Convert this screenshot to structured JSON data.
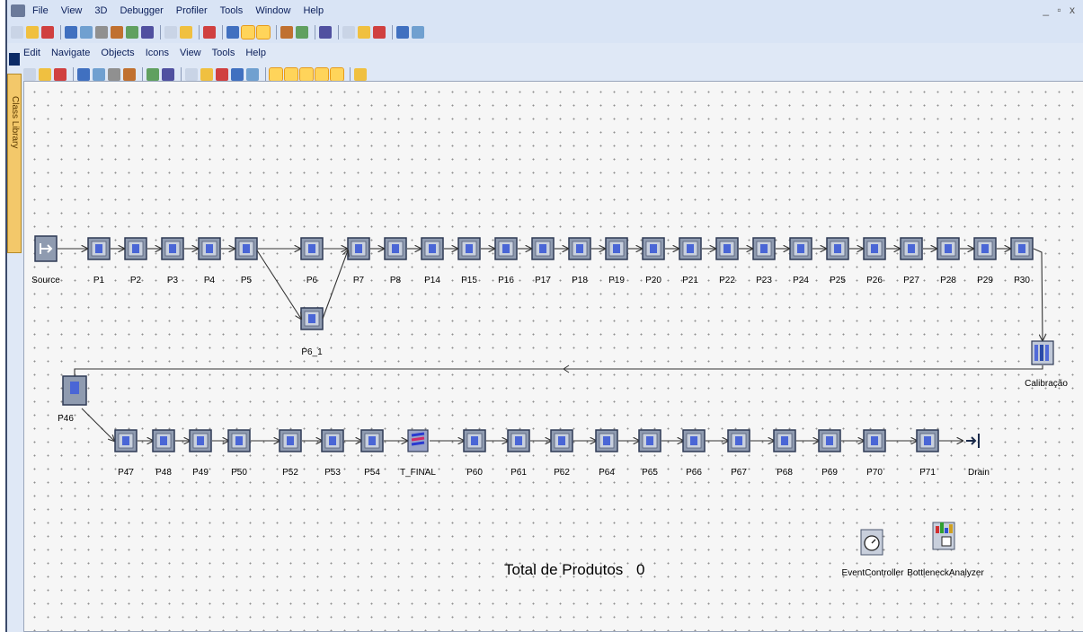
{
  "main_menu": [
    "File",
    "View",
    "3D",
    "Debugger",
    "Profiler",
    "Tools",
    "Window",
    "Help"
  ],
  "window_controls": "_ ▫ x",
  "sub_menu": [
    "Edit",
    "Navigate",
    "Objects",
    "Icons",
    "View",
    "Tools",
    "Help"
  ],
  "class_library_label": "Class Library",
  "toolbar_top_icons": [
    "new-icon",
    "open-icon",
    "open-folder-icon",
    "save-icon",
    "save-all-icon",
    "frame-icon",
    "frame-red-icon",
    "dialog-icon",
    "wizard-icon",
    "library-icon",
    "network-icon",
    "info-icon",
    "event-controller-icon",
    "gear-active-icon",
    "gear-yellow-icon",
    "3d-icon",
    "3d-off-icon",
    "copy-icon",
    "debug-icon",
    "profiler-icon",
    "profiler-red-icon",
    "window-icon",
    "window-tile-icon"
  ],
  "toolbar_sub_icons": [
    "binoculars-icon",
    "go-home-icon",
    "parent-icon",
    "event-icon",
    "reset-icon",
    "play-icon",
    "step-icon",
    "trash-icon",
    "broom-icon",
    "zoom-in-icon",
    "zoom-out-icon",
    "fit-icon",
    "print-icon",
    "pen-icon",
    "connect-icon",
    "flow-icon",
    "comment-icon",
    "grid-icon",
    "bottleneck-icon",
    "info-icon"
  ],
  "model": {
    "row1_labels": [
      "Source",
      "P1",
      "P2",
      "P3",
      "P4",
      "P5",
      "P6",
      "P7",
      "P8",
      "P14",
      "P15",
      "P16",
      "P17",
      "P18",
      "P19",
      "P20",
      "P21",
      "P22",
      "P23",
      "P24",
      "P25",
      "P26",
      "P27",
      "P28",
      "P29",
      "P30"
    ],
    "branch_label": "P6_1",
    "calibration_label": "Calibração",
    "p46_label": "P46",
    "row2_labels": [
      "P47",
      "P48",
      "P49",
      "P50",
      "P52",
      "P53",
      "P54",
      "T_FINAL",
      "P60",
      "P61",
      "P62",
      "P64",
      "P65",
      "P66",
      "P67",
      "P68",
      "P69",
      "P70",
      "P71",
      "Drain"
    ],
    "event_controller_label": "EventController",
    "bottleneck_label": "BottleneckAnalyzer",
    "total_label": "Total de Produtos",
    "total_value": "0"
  },
  "colors": {
    "station_fill": "#8f9bb0",
    "station_core": "#4a66d6",
    "arrow": "#333333",
    "accent_toolbar": "#ffd45a"
  }
}
